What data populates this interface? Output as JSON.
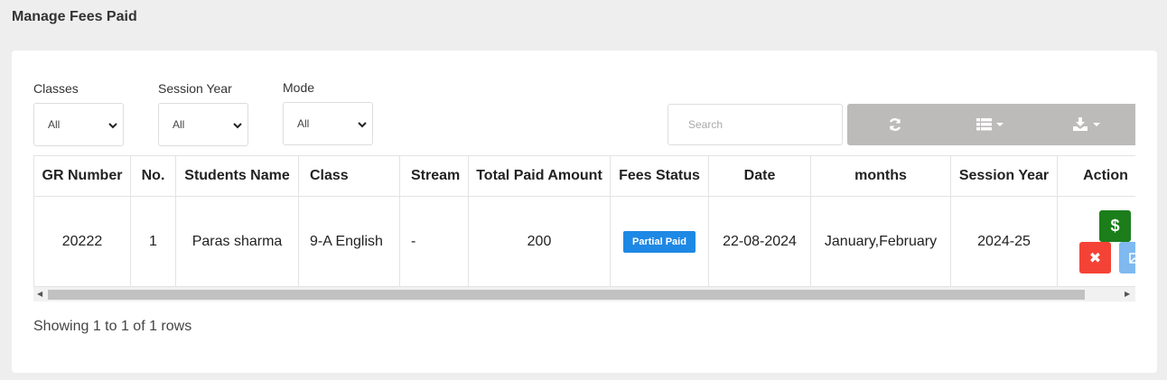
{
  "page": {
    "title": "Manage Fees Paid"
  },
  "filters": [
    {
      "label": "Classes",
      "value": "All"
    },
    {
      "label": "Session Year",
      "value": "All"
    },
    {
      "label": "Mode",
      "value": "All"
    }
  ],
  "search": {
    "placeholder": "Search"
  },
  "toolbar": {
    "refresh_icon": "refresh-icon",
    "columns_icon": "columns-list-icon",
    "export_icon": "download-icon"
  },
  "table": {
    "columns": [
      "GR Number",
      "No.",
      "Students Name",
      "Class",
      "Stream",
      "Total Paid Amount",
      "Fees Status",
      "Date",
      "months",
      "Session Year",
      "Action"
    ],
    "rows": [
      {
        "gr_number": "20222",
        "no": "1",
        "student_name": "Paras sharma",
        "class": "9-A English",
        "stream": "-",
        "total_paid": "200",
        "fees_status": "Partial Paid",
        "date": "22-08-2024",
        "months": "January,February",
        "session_year": "2024-25",
        "actions": {
          "pay": "$",
          "delete": "✖",
          "view": "image-icon"
        }
      }
    ]
  },
  "pagination": {
    "summary": "Showing 1 to 1 of 1 rows"
  },
  "colors": {
    "badge": "#1e88e5",
    "pay": "#1b7e1b",
    "delete": "#f44336",
    "view": "#7fb9f0",
    "toolbar": "#bdbaba"
  }
}
